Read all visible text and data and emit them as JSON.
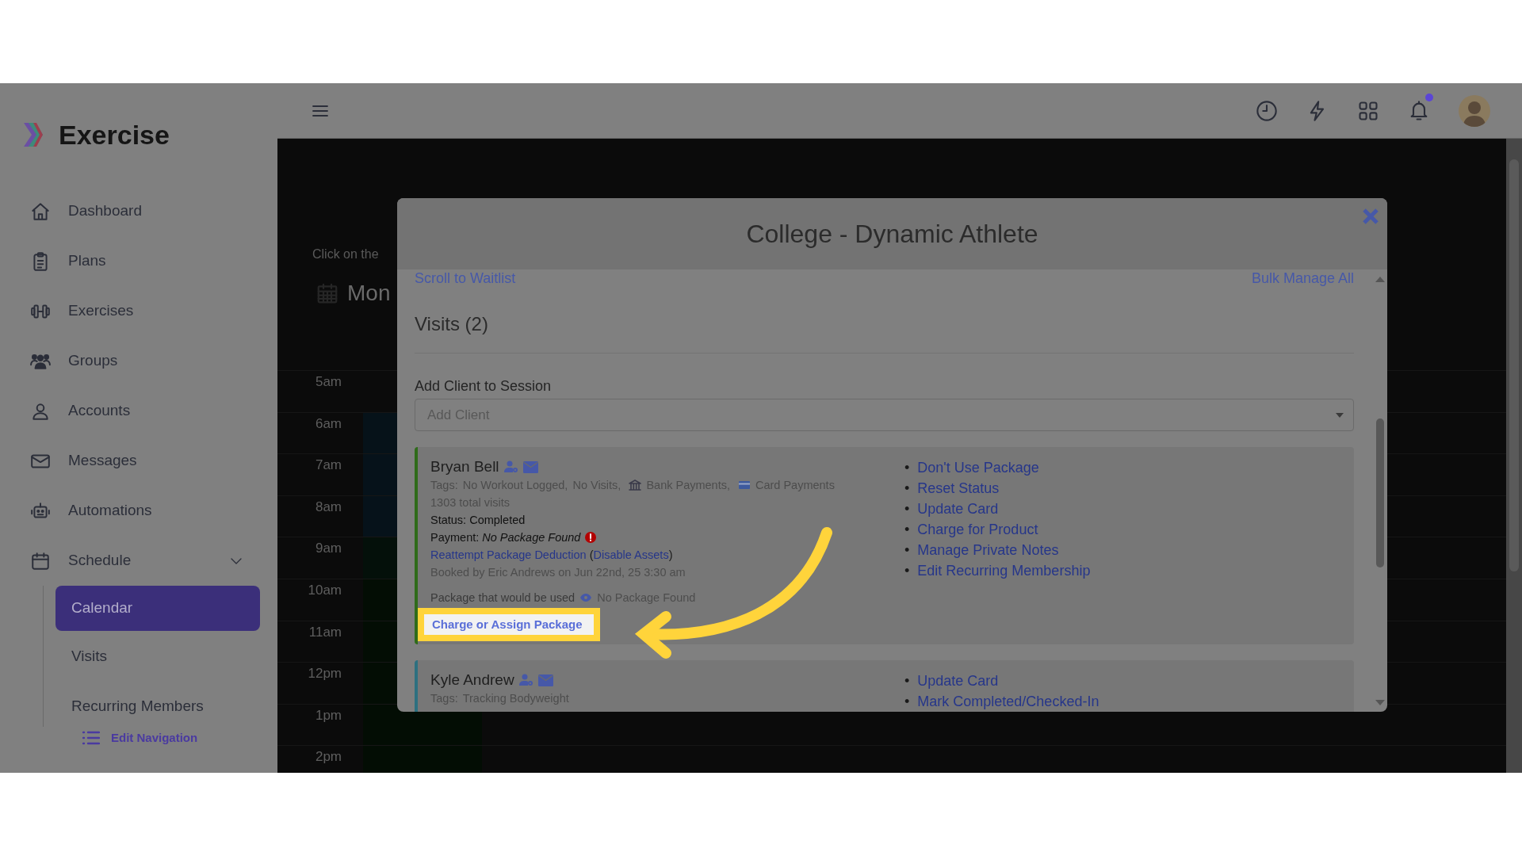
{
  "brand": {
    "name": "Exercise"
  },
  "sidebar": {
    "items": [
      {
        "label": "Dashboard",
        "selected": false
      },
      {
        "label": "Plans",
        "selected": false
      },
      {
        "label": "Exercises",
        "selected": false
      },
      {
        "label": "Groups",
        "selected": false
      },
      {
        "label": "Accounts",
        "selected": false
      },
      {
        "label": "Messages",
        "selected": false
      },
      {
        "label": "Automations",
        "selected": false
      },
      {
        "label": "Schedule",
        "selected": false,
        "expanded": true,
        "children": [
          {
            "label": "Calendar",
            "selected": true
          },
          {
            "label": "Visits",
            "selected": false
          },
          {
            "label": "Recurring Members",
            "selected": false
          }
        ]
      }
    ],
    "edit_link": "Edit Navigation"
  },
  "header": {
    "has_unread": true
  },
  "calendar": {
    "hint": "Click on the",
    "date": "Mon",
    "hours": [
      "5am",
      "6am",
      "7am",
      "8am",
      "9am",
      "10am",
      "11am",
      "12pm",
      "1pm",
      "2pm"
    ]
  },
  "modal": {
    "title": "College - Dynamic Athlete",
    "scroll_link": "Scroll to Waitlist",
    "bulk_link": "Bulk Manage All",
    "visits_heading": "Visits (2)",
    "add_label": "Add Client to Session",
    "add_placeholder": "Add Client",
    "bullet": "•",
    "visits": [
      {
        "name": "Bryan Bell",
        "color": "#2f6b1a",
        "tags_label": "Tags:",
        "tags": [
          {
            "text": "No Workout Logged,",
            "kind": "plain"
          },
          {
            "text": "No Visits,",
            "kind": "plain"
          },
          {
            "text": "Bank Payments,",
            "kind": "bank"
          },
          {
            "text": "Card Payments",
            "kind": "card"
          }
        ],
        "visits_count": "1303 total visits",
        "status": "Status: Completed",
        "payment": "Payment: *No Package Found*",
        "payment_warning": true,
        "deduction_line": [
          {
            "text": "Reattempt Package Deduction",
            "kind": "link"
          },
          {
            "text": " (",
            "kind": "text"
          },
          {
            "text": "Disable Assets",
            "kind": "link"
          },
          {
            "text": ")",
            "kind": "text"
          }
        ],
        "booked": "Booked by Eric Andrews on Jun 22nd, 25 3:30 am",
        "package_label": "Package that would be used",
        "package_value": "No Package Found",
        "charge_button": "Charge or Assign Package",
        "highlighted": true,
        "actions": [
          "Don't Use Package",
          "Reset Status",
          "Update Card",
          "Charge for Product",
          "Manage Private Notes",
          "Edit Recurring Membership"
        ]
      },
      {
        "name": "Kyle Andrew",
        "color": "#2d7080",
        "tags_label": "Tags:",
        "tags": [
          {
            "text": "Tracking Bodyweight",
            "kind": "plain"
          }
        ],
        "actions": [
          "Update Card",
          "Mark Completed/Checked-In"
        ]
      }
    ]
  }
}
